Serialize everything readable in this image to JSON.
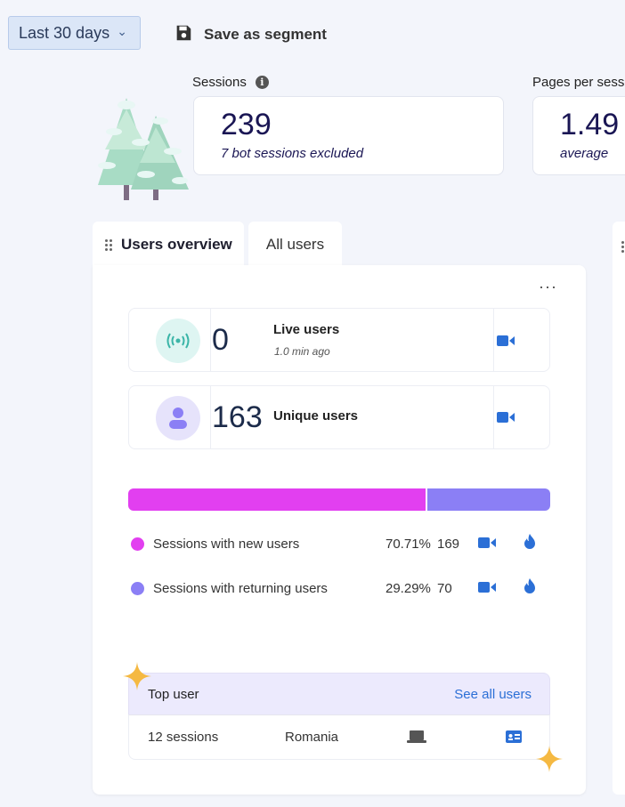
{
  "toolbar": {
    "date_range": "Last 30 days",
    "save_segment": "Save as segment"
  },
  "metrics": [
    {
      "label": "Sessions",
      "value": "239",
      "sub": "7 bot sessions excluded"
    },
    {
      "label": "Pages per sessi",
      "value": "1.49",
      "sub": "average"
    }
  ],
  "tabs": {
    "active": "Users overview",
    "inactive": "All users"
  },
  "live_users": {
    "value": "0",
    "title": "Live users",
    "sub": "1.0 min ago"
  },
  "unique_users": {
    "value": "163",
    "title": "Unique users"
  },
  "split": {
    "new_fraction": 0.7071,
    "colors": {
      "new": "#e23ff0",
      "returning": "#8b7ff5"
    }
  },
  "legend": [
    {
      "label": "Sessions with new users",
      "percent": "70.71%",
      "count": "169"
    },
    {
      "label": "Sessions with returning users",
      "percent": "29.29%",
      "count": "70"
    }
  ],
  "top_user": {
    "title": "Top user",
    "see_all": "See all users",
    "sessions": "12 sessions",
    "country": "Romania"
  },
  "icons": [
    "chevron-down-icon",
    "save-icon",
    "info-icon",
    "drag-handle-icon",
    "more-icon",
    "live-signal-icon",
    "user-icon",
    "video-icon",
    "flame-icon",
    "laptop-icon",
    "contact-card-icon",
    "sparkle-icon",
    "tree-illustration"
  ]
}
